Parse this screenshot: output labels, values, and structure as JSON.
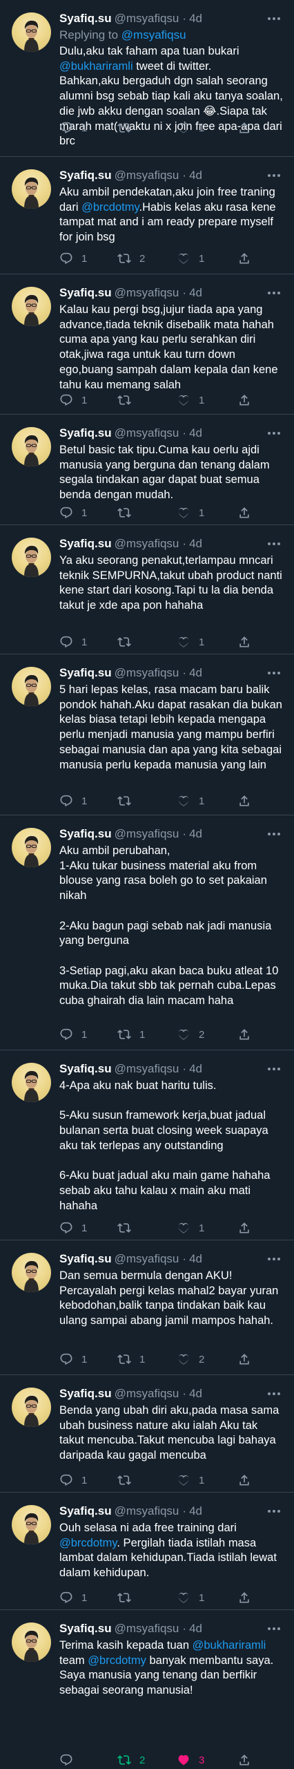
{
  "author": {
    "name": "Syafiq.su",
    "handle": "@msyafiqsu",
    "separator": "·",
    "time": "4d"
  },
  "reply_prefix": "Replying to",
  "reply_handle": "@msyafiqsu",
  "icons": {
    "reply": "reply-icon",
    "retweet": "retweet-icon",
    "like": "heart-icon",
    "share": "share-icon",
    "more": "more-icon"
  },
  "colors": {
    "background": "#15202b",
    "link": "#1d9bf0",
    "muted": "#8b98a5",
    "retweet_active": "#00ba7c",
    "like_active": "#f91880"
  },
  "tweets": [
    {
      "segments": [
        {
          "t": "Dulu,aku tak faham apa tuan bukari "
        },
        {
          "t": "@bukharirамli"
        },
        {
          "t": " tweet di twitter.\nBahkan,aku bergaduh dgn salah seorang alumni bsg sebab tiap kali aku tanya soalan, die jwb akku dengan soalan 😂.Siapa tak marah mat( waktu ni x join free apa-apa dari brc"
        }
      ],
      "replies": "1",
      "retweets": "",
      "likes": "1"
    },
    {
      "segments": [
        {
          "t": "Aku ambil pendekatan,aku join free traning dari "
        },
        {
          "t": "@brcdotmy"
        },
        {
          "t": ".Habis kelas aku rasa kene tampat mat and i am ready prepare myself for join bsg"
        }
      ],
      "replies": "1",
      "retweets": "2",
      "likes": "1"
    },
    {
      "segments": [
        {
          "t": "Kalau kau pergi bsg,jujur tiada apa yang advance,tiada teknik disebalik mata hahah cuma apa yang kau perlu serahkan diri otak,jiwa raga untuk kau turn down ego,buang sampah dalam kepala dan kene tahu kau memang salah"
        }
      ],
      "replies": "1",
      "retweets": "",
      "likes": "1"
    },
    {
      "segments": [
        {
          "t": "Betul basic tak tipu.Cuma kau oerlu ajdi manusia yang berguna dan tenang dalam segala tindakan agar dapat buat semua benda dengan mudah."
        }
      ],
      "replies": "1",
      "retweets": "",
      "likes": "1"
    },
    {
      "segments": [
        {
          "t": "Ya aku seorang penakut,terlampau mncari teknik SEMPURNA,takut ubah product nanti kene start dari kosong.Tapi tu la dia benda takut je xde apa pon hahaha"
        }
      ],
      "replies": "1",
      "retweets": "",
      "likes": "1"
    },
    {
      "segments": [
        {
          "t": "5 hari lepas kelas, rasa macam baru balik pondok hahah.Aku dapat rasakan dia bukan kelas biasa tetapi lebih kepada mengapa perlu menjadi manusia yang mampu berfiri sebagai manusia dan apa yang kita sebagai manusia perlu kepada manusia yang lain"
        }
      ],
      "replies": "1",
      "retweets": "",
      "likes": "1"
    },
    {
      "segments": [
        {
          "t": "Aku ambil perubahan,\n1-Aku tukar business material aku from blouse yang rasa boleh go to set pakaian nikah\n\n2-Aku bagun pagi sebab nak jadi manusia yang berguna\n\n3-Setiap pagi,aku akan baca buku atleat 10 muka.Dia takut sbb tak pernah cuba.Lepas cuba ghairah dia lain macam haha"
        }
      ],
      "replies": "1",
      "retweets": "1",
      "likes": "2"
    },
    {
      "segments": [
        {
          "t": "4-Apa aku nak buat haritu tulis.\n\n5-Aku susun framework kerja,buat jadual bulanan serta buat closing week suapaya aku tak terlepas any outstanding\n\n6-Aku buat jadual aku main game hahaha sebab aku tahu kalau x main aku mati hahaha"
        }
      ],
      "replies": "1",
      "retweets": "",
      "likes": "1"
    },
    {
      "segments": [
        {
          "t": "Dan semua bermula dengan AKU!\nPercayalah pergi kelas mahal2 bayar yuran kebodohan,balik tanpa tindakan baik kau ulang sampai abang jamil mampos hahah."
        }
      ],
      "replies": "1",
      "retweets": "1",
      "likes": "2"
    },
    {
      "segments": [
        {
          "t": "Benda yang ubah diri aku,pada masa sama ubah business nature aku ialah Aku tak takut mencuba.Takut mencuba lagi bahaya daripada kau gagal mencuba"
        }
      ],
      "replies": "1",
      "retweets": "",
      "likes": "1"
    },
    {
      "segments": [
        {
          "t": "Ouh selasa ni ada free training dari "
        },
        {
          "t": "@brcdotmy"
        },
        {
          "t": ". Pergilah tiada istilah masa lambat dalam kehidupan.Tiada istilah lewat dalam kehidupan."
        }
      ],
      "replies": "1",
      "retweets": "",
      "likes": "1"
    },
    {
      "segments": [
        {
          "t": "Terima kasih kepada tuan "
        },
        {
          "t": "@bukharirамli"
        },
        {
          "t": " team "
        },
        {
          "t": "@brcdotmy"
        },
        {
          "t": " banyak membantu saya.\nSaya manusia yang tenang dan berfikir sebagai seorang manusia!"
        }
      ],
      "replies": "",
      "retweets": "2",
      "likes": "3"
    }
  ]
}
